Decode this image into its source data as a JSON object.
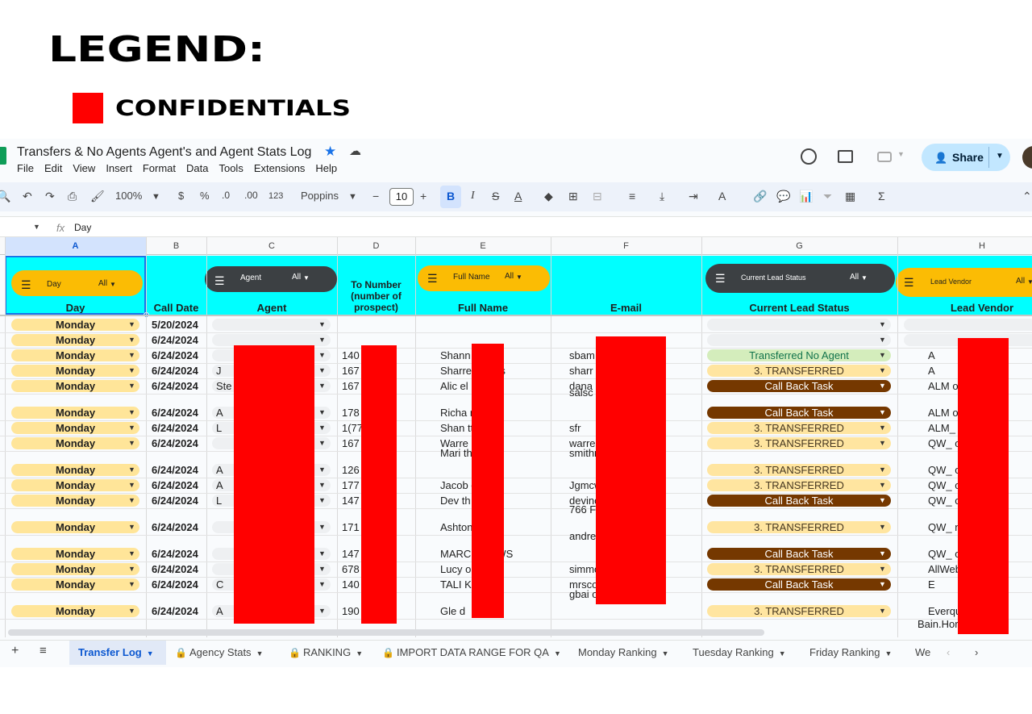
{
  "legend": {
    "title": "LEGEND:",
    "swatch_color": "#ff0000",
    "swatch_label": "CONFIDENTIALS"
  },
  "doc": {
    "title": "Transfers & No Agents Agent's and Agent Stats Log",
    "star_icon": "star-icon",
    "cloud_icon": "cloud-icon"
  },
  "menu": [
    "File",
    "Edit",
    "View",
    "Insert",
    "Format",
    "Data",
    "Tools",
    "Extensions",
    "Help"
  ],
  "share": {
    "label": "Share"
  },
  "toolbar": {
    "zoom": "100%",
    "currency": "$",
    "percent": "%",
    "dec_decrease": ".0",
    "dec_increase": ".00",
    "num_format": "123",
    "font": "Poppins",
    "font_size": "10",
    "minus": "−",
    "plus": "+",
    "bold": "B",
    "italic": "I"
  },
  "formula": {
    "fx": "fx",
    "content": "Day"
  },
  "columns": [
    "A",
    "B",
    "C",
    "D",
    "E",
    "F",
    "G",
    "H"
  ],
  "headers": {
    "day": "Day",
    "call_date": "Call Date",
    "agent": "Agent",
    "to_number_line1": "To Number",
    "to_number_line2": "(number of",
    "to_number_line3": "prospect)",
    "full_name": "Full Name",
    "email": "E-mail",
    "lead_status": "Current Lead Status",
    "lead_vendor": "Lead Vendor"
  },
  "filters": {
    "day": {
      "label": "Day",
      "value": "All"
    },
    "agent": {
      "label": "Agent",
      "value": "All"
    },
    "full_name": {
      "label": "Full Name",
      "value": "All"
    },
    "lead_status": {
      "label": "Current Lead Status",
      "value": "All"
    },
    "lead_vendor": {
      "label": "Lead Vendor",
      "value": "All"
    }
  },
  "rows": [
    {
      "day": "Monday",
      "date": "5/20/2024",
      "agent": "",
      "number": "",
      "name": "",
      "email": "",
      "status": "",
      "vendor": ""
    },
    {
      "day": "Monday",
      "date": "6/24/2024",
      "agent": "",
      "number": "",
      "name": "",
      "email": "",
      "status": "",
      "vendor": ""
    },
    {
      "day": "Monday",
      "date": "6/24/2024",
      "agent": "",
      "number": "140      49",
      "name": "Shann          eira",
      "email": "sbam                    .com",
      "status": "Transferred No Agent",
      "vendor": "A"
    },
    {
      "day": "Monday",
      "date": "6/24/2024",
      "agent": "J",
      "number": "167      90",
      "name": "Sharres         mons",
      "email": "sharr                    com",
      "status": "3. TRANSFERRED",
      "vendor": "A"
    },
    {
      "day": "Monday",
      "date": "6/24/2024",
      "agent": "Ste",
      "number": "167      47",
      "name": "Alic          el",
      "email": "dana                    om",
      "status": "Call Back Task",
      "vendor": "ALM                o"
    },
    {
      "day": "Monday",
      "date": "6/24/2024",
      "agent": "A",
      "number": "178      33",
      "name": "Richa          ra",
      "email": "salsc                    m",
      "status": "Call Back Task",
      "vendor": "ALM                o"
    },
    {
      "day": "Monday",
      "date": "6/24/2024",
      "agent": "L",
      "number": "1(770      183",
      "name": "Shan          tts",
      "email": "sfr",
      "status": "3. TRANSFERRED",
      "vendor": "ALM_               ne"
    },
    {
      "day": "Monday",
      "date": "6/24/2024",
      "agent": "",
      "number": "167      28",
      "name": "Warre          dell",
      "email": "warren                    com",
      "status": "3. TRANSFERRED",
      "vendor": "QW_               o"
    },
    {
      "day": "Monday",
      "date": "6/24/2024",
      "agent": "A",
      "number": "126      25",
      "name": "Mari          th",
      "email": "smithm                    com",
      "status": "3. TRANSFERRED",
      "vendor": "QW_               o"
    },
    {
      "day": "Monday",
      "date": "6/24/2024",
      "agent": "A",
      "number": "177      30",
      "name": "Jacob          orter",
      "email": "Jgmcw                    .com",
      "status": "3. TRANSFERRED",
      "vendor": "QW_               o"
    },
    {
      "day": "Monday",
      "date": "6/24/2024",
      "agent": "L",
      "number": "147      59",
      "name": "Dev          th",
      "email": "devinc                    com",
      "status": "Call Back Task",
      "vendor": "QW_               o"
    },
    {
      "day": "Monday",
      "date": "6/24/2024",
      "agent": "",
      "number": "171      61",
      "name": "Ashton          ope",
      "email": "766 Fai                    VILLE,",
      "status": "3. TRANSFERRED",
      "vendor": "QW_               ne"
    },
    {
      "day": "Monday",
      "date": "6/24/2024",
      "agent": "",
      "number": "147      66",
      "name": "MARCU          REWS",
      "email": "andrews                    mail.co",
      "status": "Call Back Task",
      "vendor": "QW_               o"
    },
    {
      "day": "Monday",
      "date": "6/24/2024",
      "agent": "",
      "number": "678      35",
      "name": "Lucy          ons",
      "email": "simmons                    il.com",
      "status": "3. TRANSFERRED",
      "vendor": "AllWebLe               e_Jos"
    },
    {
      "day": "Monday",
      "date": "6/24/2024",
      "agent": "C",
      "number": "140      64",
      "name": "TALI          KE",
      "email": "mrsco                    .com",
      "status": "Call Back Task",
      "vendor": "E"
    },
    {
      "day": "Monday",
      "date": "6/24/2024",
      "agent": "A",
      "number": "190      80",
      "name": "Gle          d",
      "email": "gbai                    om",
      "status": "3. TRANSFERRED",
      "vendor": "Everquo               Home"
    }
  ],
  "extra_vendor": "Bain.Hor               otes-",
  "tabs": [
    {
      "label": "Transfer Log",
      "active": true,
      "locked": false
    },
    {
      "label": "Agency Stats",
      "active": false,
      "locked": true
    },
    {
      "label": "RANKING",
      "active": false,
      "locked": true
    },
    {
      "label": "IMPORT DATA RANGE FOR QA",
      "active": false,
      "locked": true
    },
    {
      "label": "Monday Ranking",
      "active": false,
      "locked": false
    },
    {
      "label": "Tuesday Ranking",
      "active": false,
      "locked": false
    },
    {
      "label": "Friday Ranking",
      "active": false,
      "locked": false
    },
    {
      "label": "We",
      "active": false,
      "locked": false
    }
  ],
  "colors": {
    "cyan_header": "#00ffff",
    "redaction": "#ff0000",
    "filter_yellow": "#fbbc04",
    "filter_dark": "#3c4043"
  }
}
